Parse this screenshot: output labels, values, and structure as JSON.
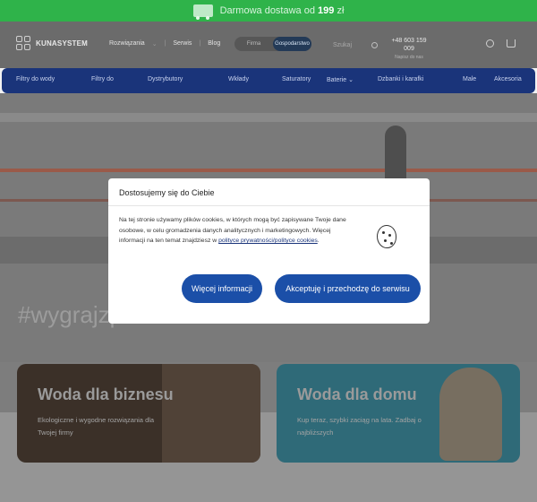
{
  "topbar": {
    "text": "Darmowa dostawa od",
    "amount": "199",
    "currency": "zł",
    "icon": "truck-icon"
  },
  "header": {
    "logo_mark": "KUNA",
    "logo_text_bold": "KUNA",
    "logo_text_rest": "SYSTEM",
    "nav": [
      "Rozwiązania",
      "Serwis",
      "Blog"
    ],
    "toggle": {
      "left": "Firma",
      "right": "Gospodarstwo"
    },
    "search_placeholder": "Szukaj",
    "phone": "+48 603 159 009",
    "phone_caption": "Napisz do nas",
    "icons": [
      "user-icon",
      "cart-icon"
    ]
  },
  "catnav": {
    "items": [
      "Filtry do wody",
      "Filtry do",
      "Dystrybutory",
      "Wkłady",
      "Saturatory",
      "Baterie",
      "Dzbanki i karafki",
      "Male",
      "Akcesoria"
    ]
  },
  "hero": {
    "hashtag": "#wygrajzplastikiem"
  },
  "cards": [
    {
      "title": "Woda dla biznesu",
      "text": "Ekologiczne i wygodne rozwiązania dla Twojej firmy"
    },
    {
      "title": "Woda dla domu",
      "text": "Kup teraz, szybki zaciąg na lata. Zadbaj o najbliższych"
    }
  ],
  "cookie_modal": {
    "title": "Dostosujemy się do Ciebie",
    "text": "Na tej stronie używamy plików cookies, w których mogą być zapisywane Twoje dane osobowe, w celu gromadzenia danych analitycznych i marketingowych. Więcej informacji na ten temat znajdziesz w",
    "link": "polityce prywatności/polityce cookies",
    "link_after": ".",
    "more_button": "Więcej informacji",
    "accept_button": "Akceptuję i przechodzę do serwisu"
  }
}
